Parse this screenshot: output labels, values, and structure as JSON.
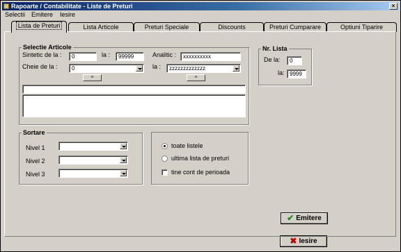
{
  "window": {
    "title": "Rapoarte / Contabilitate - Liste de Preturi",
    "close_glyph": "×"
  },
  "menu": [
    "Selectii",
    "Emitere",
    "Iesire"
  ],
  "tabs": [
    "Lista de Preturi",
    "Lista Articole",
    "Preturi Speciale",
    "Discounts",
    "Preturi Cumparare",
    "Optiuni Tiparire"
  ],
  "selectie": {
    "title": "Selectie Articole",
    "sintetic_label": "Sintetic  de la :",
    "sintetic_from": "0",
    "la_label": "la :",
    "sintetic_to": "99999",
    "analitic_label": "Analitic :",
    "analitic_value": "xxxxxxxxxx",
    "cheie_label": "Cheie  de la :",
    "cheie_from": "0",
    "cheie_la_label": "la :",
    "cheie_to": "zzzzzzzzzzzzz",
    "up_glyph": "^"
  },
  "nr_lista": {
    "title": "Nr. Lista",
    "de_la_label": "De la:",
    "de_la_value": "0",
    "la_label": "la:",
    "la_value": "9999"
  },
  "sortare": {
    "title": "Sortare",
    "levels": [
      "Nivel 1",
      "Nivel 2",
      "Nivel 3"
    ]
  },
  "options": {
    "radio1": "toate listele",
    "radio2": "ultima lista de preturi",
    "checkbox": "tine cont de perioada",
    "selected": "toate listele",
    "checked": false
  },
  "buttons": {
    "emitere": "Emitere",
    "iesire": "Iesire",
    "check_glyph": "✔",
    "x_glyph": "✖"
  },
  "colors": {
    "title_start": "#0a246a",
    "title_end": "#a6caf0",
    "face": "#d4d0c8",
    "ok_green": "#1a8a1a",
    "cancel_red": "#c00000"
  }
}
